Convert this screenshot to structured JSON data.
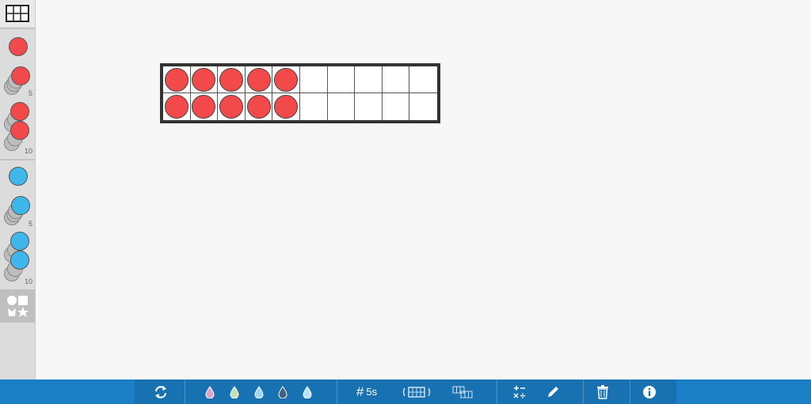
{
  "sidebar": {
    "tools": [
      {
        "name": "ten-frame-tool",
        "icon": "grid-icon"
      },
      {
        "name": "red-counter-1",
        "color": "#f24a4a"
      },
      {
        "name": "red-counter-5",
        "color": "#f24a4a",
        "label": "5"
      },
      {
        "name": "red-counter-10",
        "color": "#f24a4a",
        "label": "10"
      },
      {
        "name": "blue-counter-1",
        "color": "#3fb7ea"
      },
      {
        "name": "blue-counter-5",
        "color": "#3fb7ea",
        "label": "5"
      },
      {
        "name": "blue-counter-10",
        "color": "#3fb7ea",
        "label": "10"
      },
      {
        "name": "shapes-tool",
        "icon": "shapes-icon"
      }
    ]
  },
  "ten_frame": {
    "rows": 2,
    "columns": 10,
    "filled_per_row": 5,
    "counter_color": "#f24a4a"
  },
  "toolbar": {
    "refresh_icon": "refresh-icon",
    "drops": [
      "#d8a6c8",
      "#bfe3b6",
      "#9fd6ff",
      "#3f5f86",
      "#b9e3ff"
    ],
    "fives_label": "5s",
    "grid_icon": "grid-toggle-icon",
    "frames_icon": "ten-frames-icon",
    "math_icon": "operations-icon",
    "pen_icon": "pencil-icon",
    "trash_icon": "trash-icon",
    "info_icon": "info-icon"
  },
  "colors": {
    "toolbar_bg": "#1a7fc4",
    "toolbar_inner": "#1872b2",
    "red": "#f24a4a",
    "blue": "#3fb7ea"
  }
}
